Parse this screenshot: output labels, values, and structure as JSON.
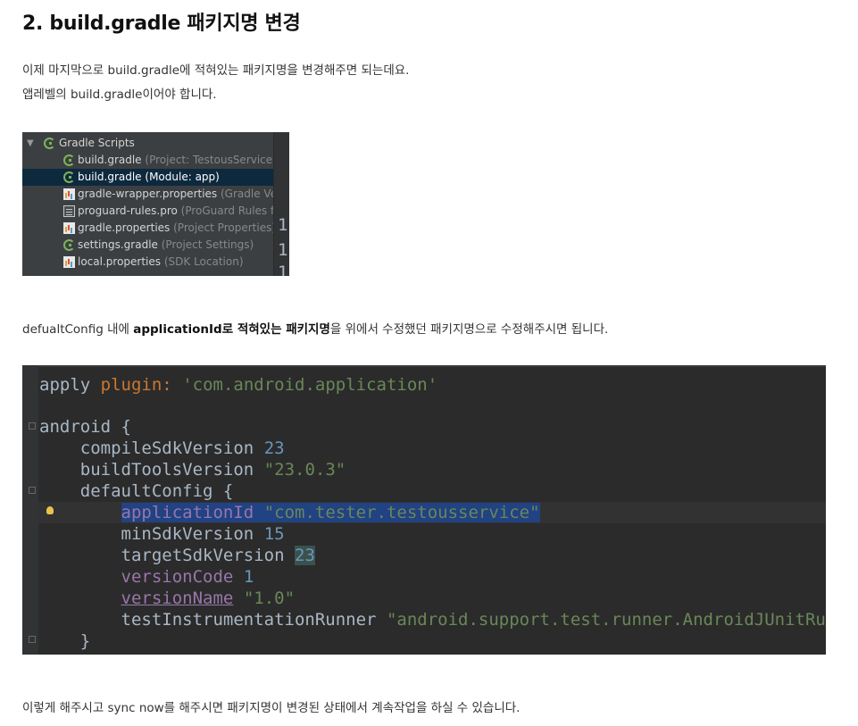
{
  "heading": "2. build.gradle 패키지명 변경",
  "intro": {
    "line1": "이제 마지막으로 build.gradle에 적혀있는 패키지명을 변경해주면 되는데요.",
    "line2": "앱레벨의 build.gradle이어야 합니다."
  },
  "project_tree": {
    "root_label": "Gradle Scripts",
    "items": [
      {
        "name": "build.gradle",
        "hint": "(Project: TestousService)",
        "icon": "gradle-icon",
        "selected": false
      },
      {
        "name": "build.gradle",
        "hint": "(Module: app)",
        "icon": "gradle-icon",
        "selected": true
      },
      {
        "name": "gradle-wrapper.properties",
        "hint": "(Gradle Ve",
        "icon": "properties-icon",
        "selected": false
      },
      {
        "name": "proguard-rules.pro",
        "hint": "(ProGuard Rules f",
        "icon": "text-file-icon",
        "selected": false
      },
      {
        "name": "gradle.properties",
        "hint": "(Project Properties)",
        "icon": "properties-icon",
        "selected": false
      },
      {
        "name": "settings.gradle",
        "hint": "(Project Settings)",
        "icon": "gradle-icon",
        "selected": false
      },
      {
        "name": "local.properties",
        "hint": "(SDK Location)",
        "icon": "properties-icon",
        "selected": false
      }
    ],
    "gutter_numbers": [
      "1",
      "1",
      "1"
    ]
  },
  "instruction": {
    "part1": "defualtConfig 내에 ",
    "bold1": "applicationId로 적혀있는 패키지명",
    "part2": "을 위에서 수정했던 패키지명으로 수정해주시면 됩니다."
  },
  "code": {
    "apply": "apply",
    "plugin": "plugin",
    "colon": ": ",
    "plugin_value": "'com.android.application'",
    "android": "android {",
    "compileSdkVersion": "compileSdkVersion",
    "compileSdkVersion_value": "23",
    "buildToolsVersion": "buildToolsVersion",
    "buildToolsVersion_value": "\"23.0.3\"",
    "defaultConfig": "defaultConfig {",
    "applicationId": "applicationId",
    "applicationId_value": "\"com.tester.testousservice\"",
    "minSdkVersion": "minSdkVersion",
    "minSdkVersion_value": "15",
    "targetSdkVersion": "targetSdkVersion",
    "targetSdkVersion_value": "23",
    "versionCode": "versionCode",
    "versionCode_value": "1",
    "versionName": "versionName",
    "versionName_value": "\"1.0\"",
    "testInstrumentationRunner": "testInstrumentationRunner",
    "testInstrumentationRunner_value": "\"android.support.test.runner.AndroidJUnitRunner\"",
    "close_brace": "}"
  },
  "outro": "이렇게 해주시고 sync now를 해주시면 패키지명이 변경된 상태에서 계속작업을 하실 수 있습니다."
}
